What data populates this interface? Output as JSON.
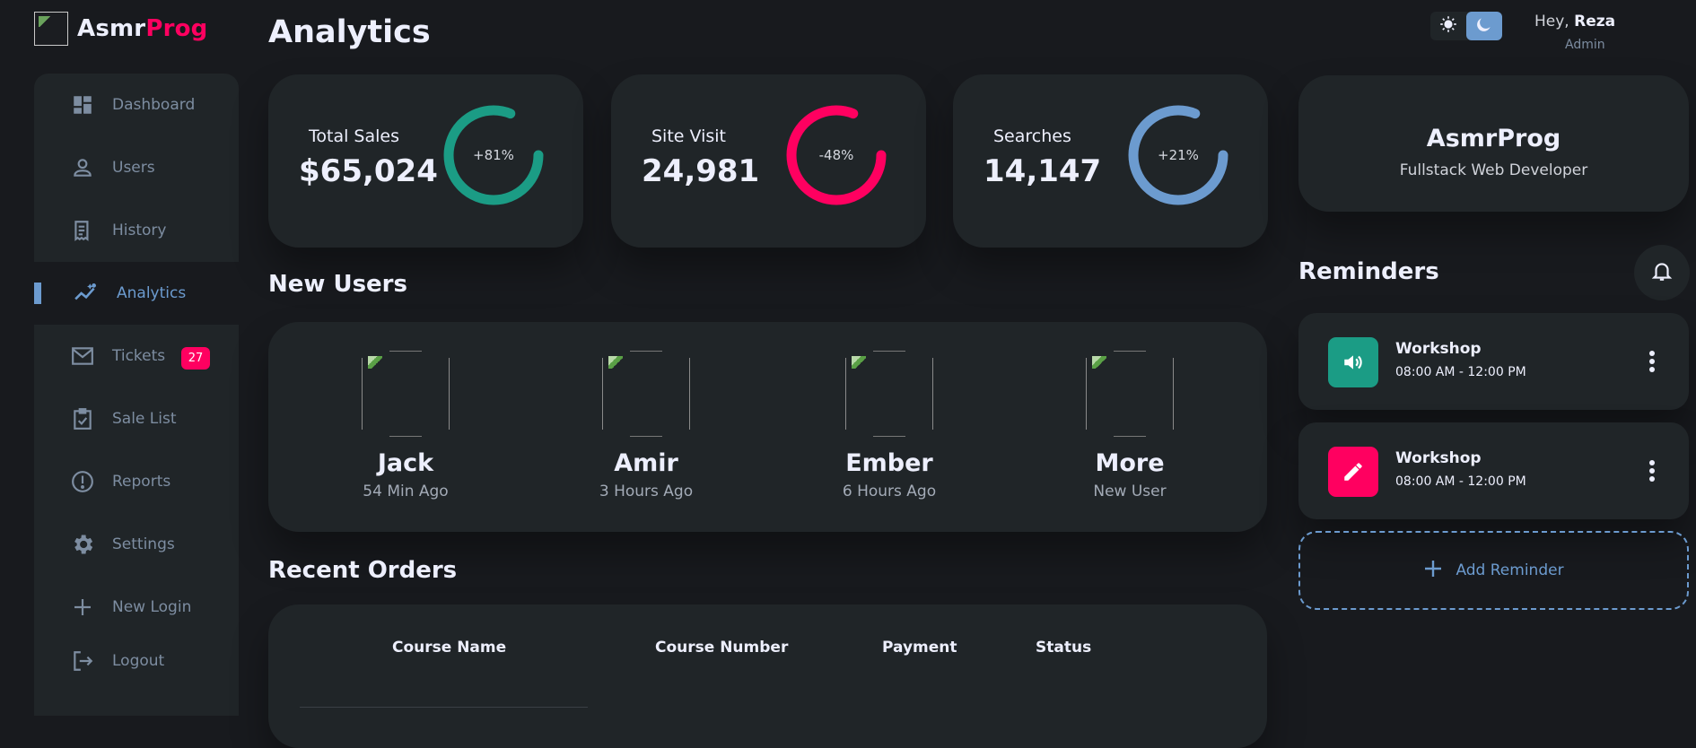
{
  "brand": {
    "part1": "Asmr",
    "part2": "Prog"
  },
  "sidebar": {
    "items": [
      {
        "label": "Dashboard",
        "icon": "dashboard-icon"
      },
      {
        "label": "Users",
        "icon": "person-icon"
      },
      {
        "label": "History",
        "icon": "receipt-icon"
      },
      {
        "label": "Analytics",
        "icon": "insights-icon",
        "active": true
      },
      {
        "label": "Tickets",
        "icon": "mail-icon",
        "badge": "27"
      },
      {
        "label": "Sale List",
        "icon": "clipboard-check-icon"
      },
      {
        "label": "Reports",
        "icon": "report-icon"
      },
      {
        "label": "Settings",
        "icon": "gear-icon"
      },
      {
        "label": "New Login",
        "icon": "plus-icon"
      },
      {
        "label": "Logout",
        "icon": "logout-icon"
      }
    ]
  },
  "page": {
    "title": "Analytics"
  },
  "stats": [
    {
      "name": "Total Sales",
      "value": "$65,024",
      "percent": "+81%",
      "color": "#1b9c85",
      "fraction": 0.81
    },
    {
      "name": "Site Visit",
      "value": "24,981",
      "percent": "-48%",
      "color": "#ff0060",
      "fraction": 0.81
    },
    {
      "name": "Searches",
      "value": "14,147",
      "percent": "+21%",
      "color": "#6c9bcf",
      "fraction": 0.81
    }
  ],
  "new_users": {
    "heading": "New Users",
    "users": [
      {
        "name": "Jack",
        "time": "54 Min Ago"
      },
      {
        "name": "Amir",
        "time": "3 Hours Ago"
      },
      {
        "name": "Ember",
        "time": "6 Hours Ago"
      },
      {
        "name": "More",
        "time": "New User"
      }
    ]
  },
  "orders": {
    "heading": "Recent Orders",
    "columns": [
      "Course Name",
      "Course Number",
      "Payment",
      "Status"
    ]
  },
  "header": {
    "greeting": "Hey,",
    "user": "Reza",
    "role": "Admin"
  },
  "profile": {
    "name": "AsmrProg",
    "role": "Fullstack Web Developer"
  },
  "reminders": {
    "heading": "Reminders",
    "items": [
      {
        "title": "Workshop",
        "time": "08:00 AM - 12:00 PM",
        "icon": "volume-icon",
        "color": "#1b9c85"
      },
      {
        "title": "Workshop",
        "time": "08:00 AM - 12:00 PM",
        "icon": "edit-icon",
        "color": "#ff0060"
      }
    ],
    "add_label": "Add Reminder"
  },
  "colors": {
    "primary": "#6c9bcf",
    "danger": "#ff0060",
    "success": "#1b9c85",
    "background": "#181a1e",
    "card": "#202528"
  }
}
